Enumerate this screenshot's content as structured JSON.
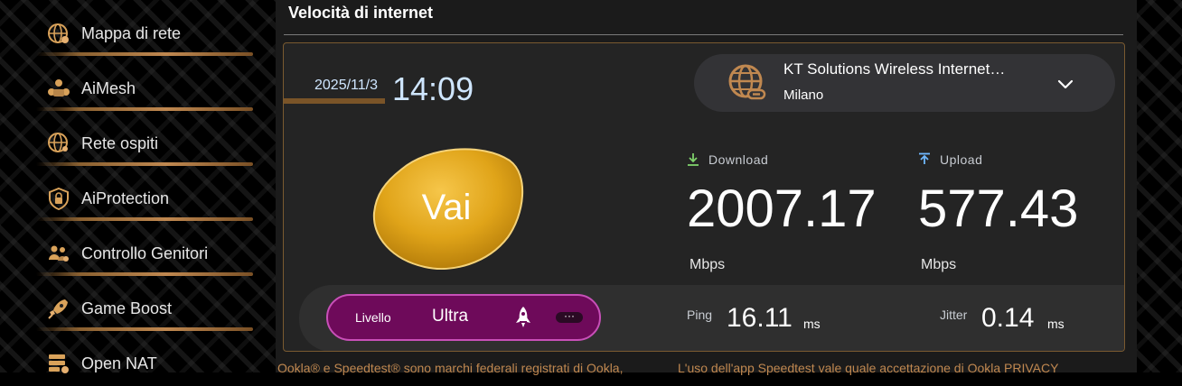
{
  "sidebar": {
    "items": [
      {
        "label": "Mappa di rete",
        "icon": "network-map-icon"
      },
      {
        "label": "AiMesh",
        "icon": "aimesh-icon"
      },
      {
        "label": "Rete ospiti",
        "icon": "guest-network-icon"
      },
      {
        "label": "AiProtection",
        "icon": "shield-lock-icon"
      },
      {
        "label": "Controllo Genitori",
        "icon": "parental-control-icon"
      },
      {
        "label": "Game Boost",
        "icon": "rocket-icon"
      },
      {
        "label": "Open NAT",
        "icon": "open-nat-icon"
      }
    ]
  },
  "main": {
    "title": "Velocità di internet"
  },
  "speedtest": {
    "date": "2025/11/3",
    "time": "14:09",
    "server_name": "KT Solutions Wireless Internet…",
    "server_city": "Milano",
    "go_label": "Vai",
    "download_label": "Download",
    "download_value": "2007.17",
    "download_unit": "Mbps",
    "upload_label": "Upload",
    "upload_value": "577.43",
    "upload_unit": "Mbps",
    "level_label": "Livello",
    "level_value": "Ultra",
    "more_label": "···",
    "ping_label": "Ping",
    "ping_value": "16.11",
    "ping_unit": "ms",
    "jitter_label": "Jitter",
    "jitter_value": "0.14",
    "jitter_unit": "ms"
  },
  "footer": {
    "left": "Ookla® e Speedtest® sono marchi federali registrati di Ookla,",
    "right": "L'uso dell'app Speedtest vale quale accettazione di Ookla PRIVACY"
  },
  "colors": {
    "accent": "#c08850",
    "level_bg": "#6e0a5a",
    "download_arrow": "#7fd16b",
    "upload_arrow": "#6fb8ff"
  }
}
